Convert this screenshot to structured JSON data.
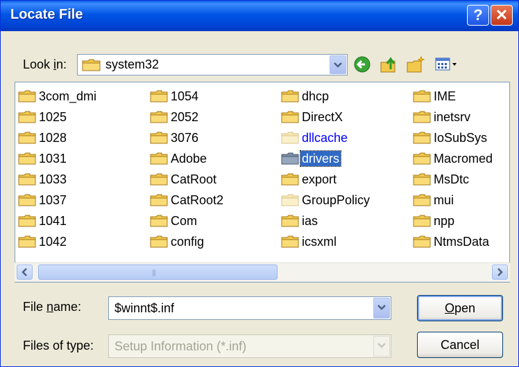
{
  "window": {
    "title": "Locate File"
  },
  "titlebar": {
    "help_glyph": "?",
    "close_glyph": "✕"
  },
  "lookin": {
    "label_pre": "Look ",
    "label_accel": "i",
    "label_post": "n:",
    "value": "system32"
  },
  "files": [
    [
      "3com_dmi",
      "1025",
      "1028",
      "1031",
      "1033",
      "1037",
      "1041",
      "1042"
    ],
    [
      "1054",
      "2052",
      "3076",
      "Adobe",
      "CatRoot",
      "CatRoot2",
      "Com",
      "config"
    ],
    [
      "dhcp",
      "DirectX",
      "dllcache",
      "drivers",
      "export",
      "GroupPolicy",
      "ias",
      "icsxml"
    ],
    [
      "IME",
      "inetsrv",
      "IoSubSys",
      "Macromed",
      "MsDtc",
      "mui",
      "npp",
      "NtmsData"
    ]
  ],
  "selected": "drivers",
  "compressed": [
    "dllcache"
  ],
  "hidden": [
    "dllcache",
    "GroupPolicy"
  ],
  "filename": {
    "label_pre": "File ",
    "label_accel": "n",
    "label_post": "ame:",
    "value": "$winnt$.inf"
  },
  "filetype": {
    "label": "Files of type:",
    "value": "Setup Information (*.inf)"
  },
  "buttons": {
    "open_accel": "O",
    "open_rest": "pen",
    "cancel": "Cancel"
  },
  "colors": {
    "titlebar": "#0055e5",
    "selection": "#316ac5",
    "compressed_text": "#0000ff"
  }
}
